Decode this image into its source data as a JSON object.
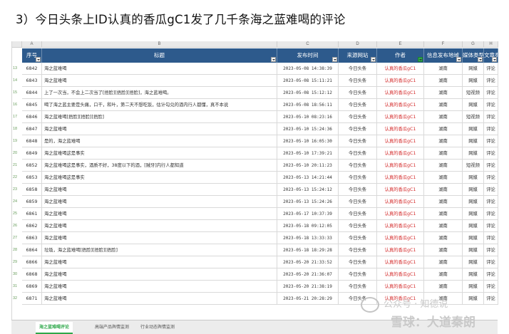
{
  "heading": "3）今日头条上ID认真的香瓜gC1发了几千条海之蓝难喝的评论",
  "column_letters": [
    "A",
    "B",
    "C",
    "D",
    "E",
    "F",
    "G",
    "H"
  ],
  "headers": [
    "序号",
    "标题",
    "发布时间",
    "来源网站",
    "作者",
    "信息发布地域",
    "媒体类型",
    "文章类型"
  ],
  "start_row_number": 13,
  "rows": [
    {
      "id": "6842",
      "title": "海之蓝难喝",
      "time": "2023-05-08 14:38:39",
      "source": "今日头条",
      "author": "认真的香瓜gC1",
      "region": "湖南",
      "media": "网媒",
      "kind": "评论"
    },
    {
      "id": "6843",
      "title": "海之蓝难喝",
      "time": "2023-05-08 15:11:21",
      "source": "今日头条",
      "author": "认真的香瓜gC1",
      "region": "湖南",
      "media": "网媒",
      "kind": "评论"
    },
    {
      "id": "6844",
      "title": "上了一次当，不会上二次当了[捂脸][捂脸][捂脸]，海之蓝难喝。",
      "time": "2023-05-08 15:12:12",
      "source": "今日头条",
      "author": "认真的香瓜gC1",
      "region": "湖南",
      "media": "短视频",
      "kind": "评论"
    },
    {
      "id": "6845",
      "title": "喝了海之蓝主要是头痛，口干，和叶，第二天不想吃饭，估计勾兑的酒内行人都懂，真不本说",
      "time": "2023-05-08 18:56:11",
      "source": "今日头条",
      "author": "认真的香瓜gC1",
      "region": "湖南",
      "media": "网媒",
      "kind": "评论"
    },
    {
      "id": "6846",
      "title": "海之蓝难喝[捂脸][捂脸][捂脸]",
      "time": "2023-05-10 08:23:16",
      "source": "今日头条",
      "author": "认真的香瓜gC1",
      "region": "湖南",
      "media": "短视频",
      "kind": "评论"
    },
    {
      "id": "6847",
      "title": "海之蓝难喝",
      "time": "2023-05-10 15:24:36",
      "source": "今日头条",
      "author": "认真的香瓜gC1",
      "region": "湖南",
      "media": "网媒",
      "kind": "评论"
    },
    {
      "id": "6848",
      "title": "是的，海之蓝难喝",
      "time": "2023-05-10 16:05:30",
      "source": "今日头条",
      "author": "认真的香瓜gC1",
      "region": "湖南",
      "media": "网媒",
      "kind": "评论"
    },
    {
      "id": "6849",
      "title": "海之蓝难喝这是事实",
      "time": "2023-05-10 17:39:21",
      "source": "今日头条",
      "author": "认真的香瓜gC1",
      "region": "湖南",
      "media": "网媒",
      "kind": "评论"
    },
    {
      "id": "6852",
      "title": "海之蓝难喝这是事实，酒质不好，38度以下的酒，[贼牙]内行人都知道",
      "time": "2023-05-10 20:11:23",
      "source": "今日头条",
      "author": "认真的香瓜gC1",
      "region": "湖南",
      "media": "短视频",
      "kind": "评论"
    },
    {
      "id": "6853",
      "title": "海之蓝难喝这是事实",
      "time": "2023-05-13 14:21:44",
      "source": "今日头条",
      "author": "认真的香瓜gC1",
      "region": "湖南",
      "media": "网媒",
      "kind": "评论"
    },
    {
      "id": "6858",
      "title": "海之蓝难喝",
      "time": "2023-05-13 15:24:12",
      "source": "今日头条",
      "author": "认真的香瓜gC1",
      "region": "湖南",
      "media": "网媒",
      "kind": "评论"
    },
    {
      "id": "6859",
      "title": "海之蓝难喝",
      "time": "2023-05-13 15:24:26",
      "source": "今日头条",
      "author": "认真的香瓜gC1",
      "region": "湖南",
      "media": "网媒",
      "kind": "评论"
    },
    {
      "id": "6861",
      "title": "海之蓝难喝",
      "time": "2023-05-17 10:37:39",
      "source": "今日头条",
      "author": "认真的香瓜gC1",
      "region": "湖南",
      "media": "网媒",
      "kind": "评论"
    },
    {
      "id": "6862",
      "title": "海之蓝难喝",
      "time": "2023-05-18 09:12:05",
      "source": "今日头条",
      "author": "认真的香瓜gC1",
      "region": "湖南",
      "media": "网媒",
      "kind": "评论"
    },
    {
      "id": "6863",
      "title": "海之蓝难喝",
      "time": "2023-05-18 13:33:33",
      "source": "今日头条",
      "author": "认真的香瓜gC1",
      "region": "湖南",
      "media": "网媒",
      "kind": "评论"
    },
    {
      "id": "6864",
      "title": "垃圾，海之蓝难喝[捂脸][捂脸][捂脸]",
      "time": "2023-05-18 18:29:28",
      "source": "今日头条",
      "author": "认真的香瓜gC1",
      "region": "湖南",
      "media": "网媒",
      "kind": "评论"
    },
    {
      "id": "6866",
      "title": "海之蓝难喝",
      "time": "2023-05-20 21:33:52",
      "source": "今日头条",
      "author": "认真的香瓜gC1",
      "region": "湖南",
      "media": "网媒",
      "kind": "评论"
    },
    {
      "id": "6868",
      "title": "海之蓝难喝",
      "time": "2023-05-20 21:36:07",
      "source": "今日头条",
      "author": "认真的香瓜gC1",
      "region": "湖南",
      "media": "网媒",
      "kind": "评论"
    },
    {
      "id": "6869",
      "title": "海之蓝难喝",
      "time": "2023-05-20 21:38:19",
      "source": "今日头条",
      "author": "认真的香瓜gC1",
      "region": "湖南",
      "media": "网媒",
      "kind": "评论"
    },
    {
      "id": "6871",
      "title": "海之蓝难喝",
      "time": "2023-05-21 20:28:29",
      "source": "今日头条",
      "author": "认真的香瓜gC1",
      "region": "湖南",
      "media": "网媒",
      "kind": "评论"
    }
  ],
  "tabs": [
    "海之蓝难喝评论",
    "高端产品舆情监测",
    "行业动态舆情监测"
  ],
  "watermark": {
    "line1": "公众号 · 知德说",
    "line2": "雪球：大道秦朗"
  },
  "colors": {
    "header_bg": "#2d5a8c",
    "author_text": "#d42a2a",
    "filter_active": "#2ea84a"
  }
}
